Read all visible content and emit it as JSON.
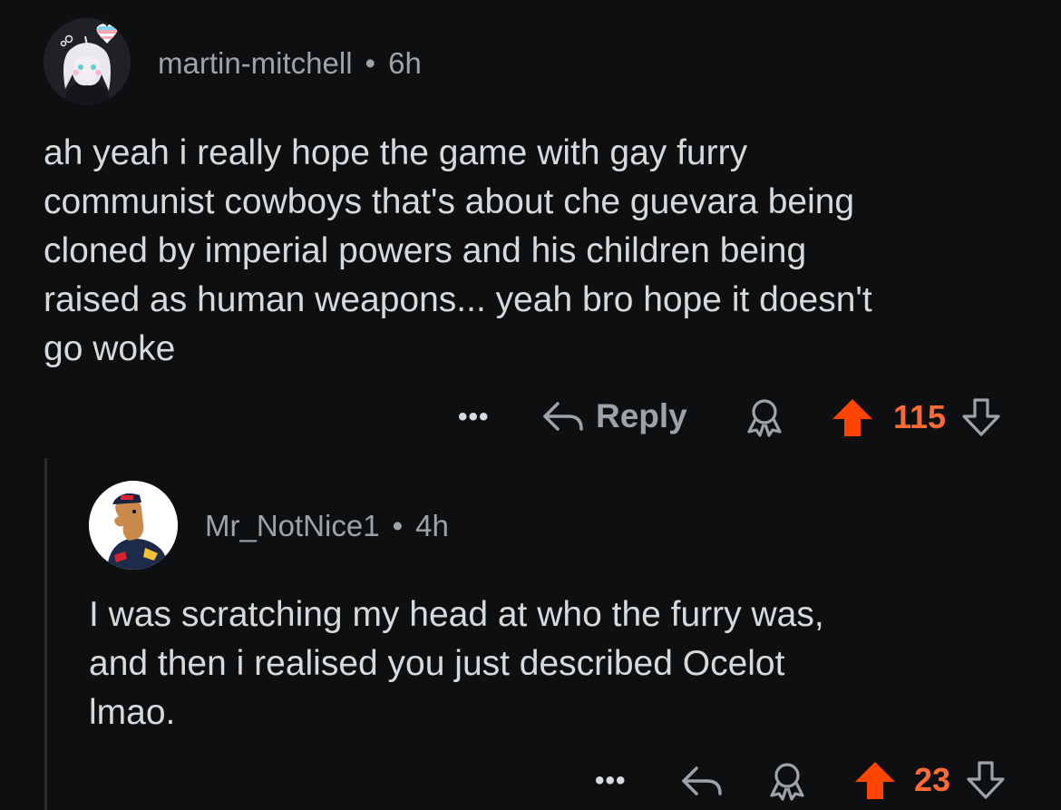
{
  "colors": {
    "background": "#0e0f11",
    "text": "#d7dadc",
    "muted": "#9ea3a8",
    "upvote": "#ff4500",
    "score": "#ff6a33"
  },
  "comments": [
    {
      "username": "martin-mitchell",
      "separator": "•",
      "time": "6h",
      "body_lines": [
        "ah yeah i really hope the game with gay furry",
        "communist cowboys that's about che guevara being",
        "cloned by imperial powers and his children being",
        "raised as human weapons... yeah bro hope it doesn't",
        "go woke"
      ],
      "more_label": "•••",
      "reply_label": "Reply",
      "score": "115",
      "upvoted": true
    },
    {
      "username": "Mr_NotNice1",
      "separator": "•",
      "time": "4h",
      "body_lines": [
        "I was scratching my head at who the furry was,",
        "and then i realised you just described Ocelot",
        "lmao."
      ],
      "more_label": "•••",
      "score": "23",
      "upvoted": true
    }
  ],
  "icons": {
    "more": "more-options-icon",
    "reply": "reply-arrow-icon",
    "award": "award-icon",
    "upvote": "upvote-arrow-icon",
    "downvote": "downvote-arrow-icon"
  }
}
